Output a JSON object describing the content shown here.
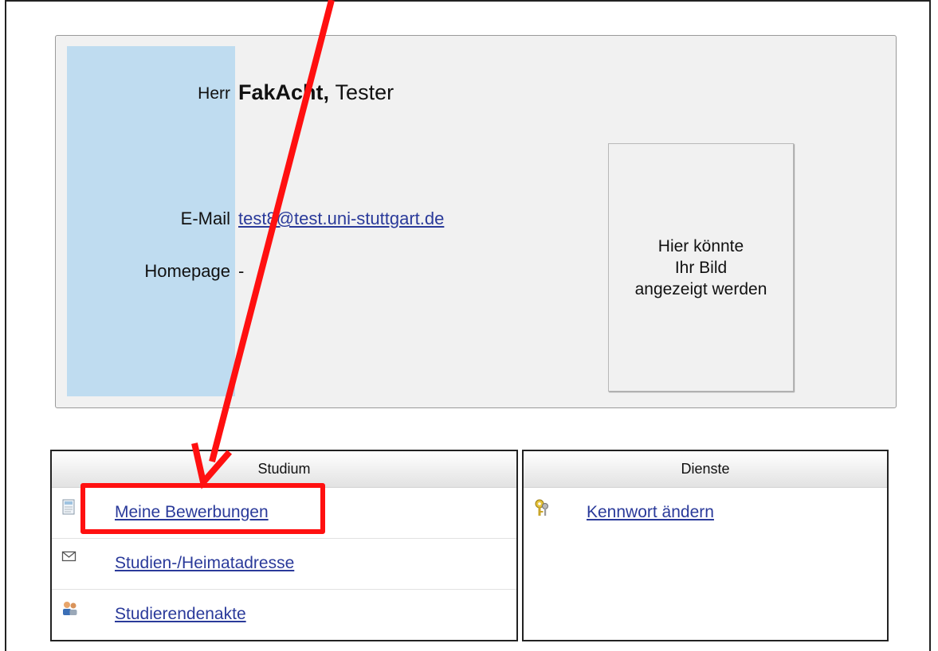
{
  "profile": {
    "salutation": "Herr",
    "surname": "FakAcht,",
    "given_name": "Tester",
    "email_label": "E-Mail",
    "email": "test8@test.uni-stuttgart.de",
    "homepage_label": "Homepage",
    "homepage": "-",
    "photo_placeholder": [
      "Hier könnte",
      "Ihr Bild",
      "angezeigt werden"
    ]
  },
  "studium": {
    "title": "Studium",
    "items": [
      {
        "label": "Meine Bewerbungen",
        "icon": "document-icon"
      },
      {
        "label": "Studien-/Heimatadresse",
        "icon": "envelope-icon"
      },
      {
        "label": "Studierendenakte",
        "icon": "users-icon"
      }
    ]
  },
  "dienste": {
    "title": "Dienste",
    "items": [
      {
        "label": "Kennwort ändern",
        "icon": "keys-icon"
      }
    ]
  },
  "annotation": {
    "color": "#ff1010"
  }
}
